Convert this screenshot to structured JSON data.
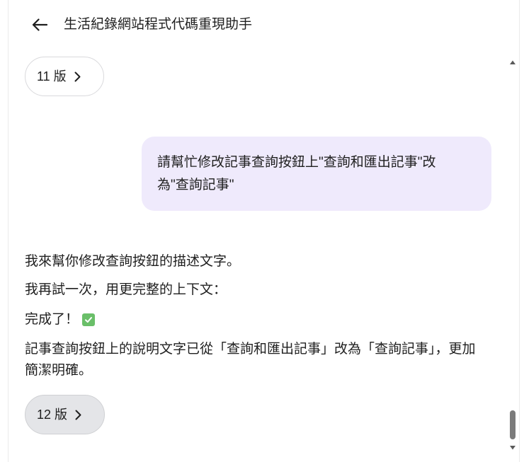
{
  "header": {
    "back_icon": "arrow-left-icon",
    "title": "生活紀錄網站程式代碼重現助手"
  },
  "version_prev": {
    "label": "11 版",
    "icon": "chevron-right-icon"
  },
  "user_message": {
    "lines": [
      "請幫忙修改記事查詢按鈕上\"查詢和匯出記事\"改",
      "為\"查詢記事\""
    ]
  },
  "assistant_message": {
    "paragraphs": [
      "我來幫你修改查詢按鈕的描述文字。",
      "我再試一次，用更完整的上下文："
    ],
    "done_text": "完成了！",
    "done_icon": "check-mark-button-icon",
    "summary_lines": [
      "記事查詢按鈕上的說明文字已從「查詢和匯出記事」改為「查詢記事」，更加",
      "簡潔明確。"
    ]
  },
  "version_next": {
    "label": "12 版",
    "icon": "chevron-right-icon"
  },
  "scrollbar": {
    "up_icon": "scroll-up-arrow-icon",
    "down_icon": "scroll-down-arrow-icon",
    "scroll_fraction": 0.99,
    "visible_fraction": 0.077
  },
  "colors": {
    "bubble_bg": "#efeafc",
    "text": "#1f1f1f",
    "next_button_bg": "#e4e5e8",
    "check_green": "#6abf69",
    "scroll_thumb": "#7b7b7b"
  }
}
